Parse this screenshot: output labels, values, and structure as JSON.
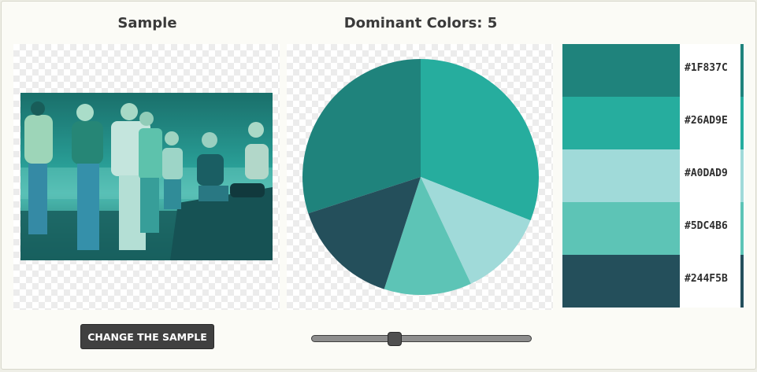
{
  "sample": {
    "heading": "Sample",
    "image_description_icon": "photo-icon"
  },
  "palette": {
    "heading": "Dominant Colors: 5",
    "colors": [
      {
        "hex": "#1F837C",
        "label": "#1F837C",
        "share": 0.3
      },
      {
        "hex": "#26AD9E",
        "label": "#26AD9E",
        "share": 0.31
      },
      {
        "hex": "#A0DAD9",
        "label": "#A0DAD9",
        "share": 0.12
      },
      {
        "hex": "#5DC4B6",
        "label": "#5DC4B6",
        "share": 0.12
      },
      {
        "hex": "#244F5B",
        "label": "#244F5B",
        "share": 0.15
      }
    ],
    "pie_start_fraction": 0.7
  },
  "controls": {
    "change_button_label": "CHANGE THE SAMPLE",
    "color_count_slider": {
      "value": 5,
      "min": 1,
      "max": 10
    }
  },
  "theme": {
    "panel_bg": "#fbfbf6",
    "button_bg": "#404040"
  }
}
